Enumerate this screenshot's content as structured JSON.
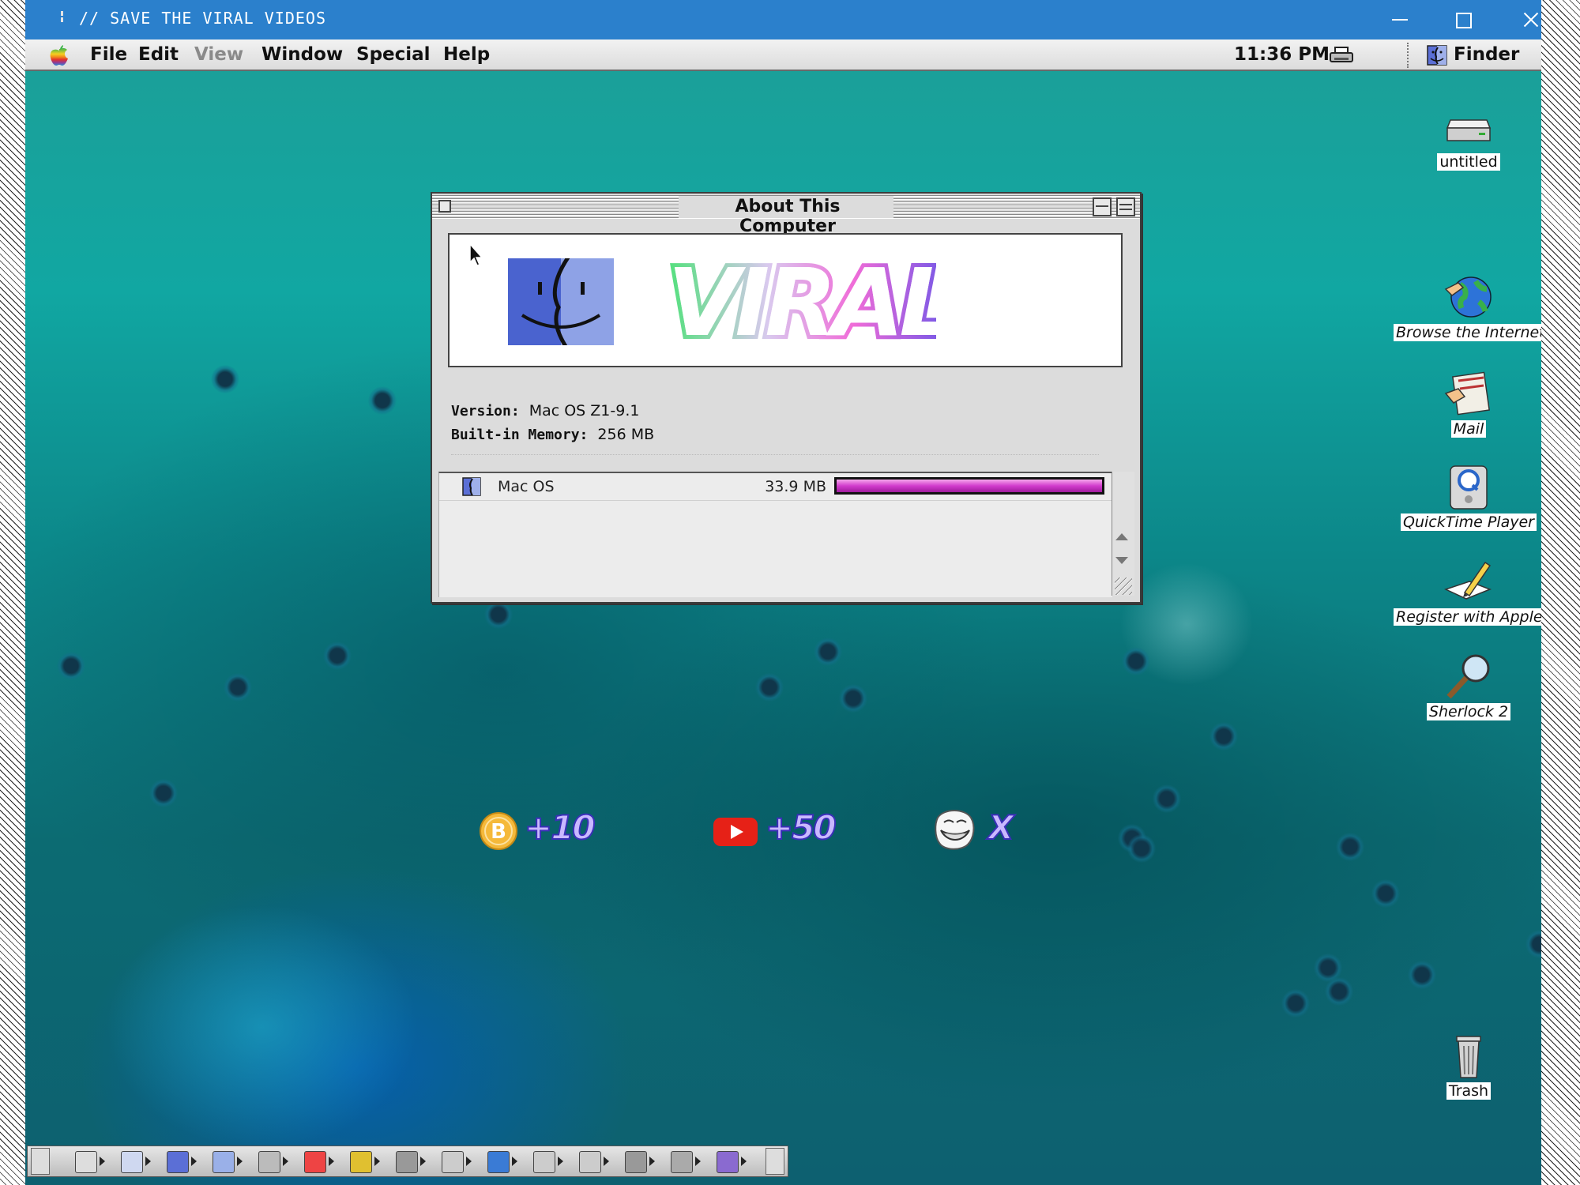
{
  "window": {
    "title": "// SAVE THE VIRAL VIDEOS",
    "minimize_glyph": "minimize-icon",
    "maximize_glyph": "maximize-icon",
    "close_glyph": "close-icon",
    "titlebar_color": "#2b80cc"
  },
  "menubar": {
    "items": [
      "File",
      "Edit",
      "View",
      "Window",
      "Special",
      "Help"
    ],
    "disabled": [
      "View"
    ],
    "clock": "11:36 PM",
    "app": "Finder"
  },
  "dialog": {
    "title": "About This Computer",
    "logo_text": "VIRAL",
    "version_label": "Version:",
    "version_value": "Mac OS Z1-9.1",
    "memory_label": "Built-in Memory:",
    "memory_value": "256 MB",
    "rows": [
      {
        "name": "Mac OS",
        "size": "33.9 MB",
        "bar_fraction": 1.0
      }
    ],
    "scores": [
      {
        "icon": "bitcoin-icon",
        "value": "+10"
      },
      {
        "icon": "youtube-icon",
        "value": "+50"
      },
      {
        "icon": "trollface-icon",
        "value": "X"
      }
    ]
  },
  "desktop_icons": [
    {
      "name": "untitled",
      "icon": "hard-disk-icon"
    },
    {
      "name": "Browse the Internet",
      "icon": "globe-icon"
    },
    {
      "name": "Mail",
      "icon": "mail-icon"
    },
    {
      "name": "QuickTime Player",
      "icon": "quicktime-icon"
    },
    {
      "name": "Register with Apple",
      "icon": "register-icon"
    },
    {
      "name": "Sherlock 2",
      "icon": "sherlock-icon"
    },
    {
      "name": "Trash",
      "icon": "trash-icon"
    }
  ],
  "colors": {
    "accent_bar": "#d23ccd",
    "desktop": "#11a7a2",
    "score_text": "#3b2fb8"
  }
}
